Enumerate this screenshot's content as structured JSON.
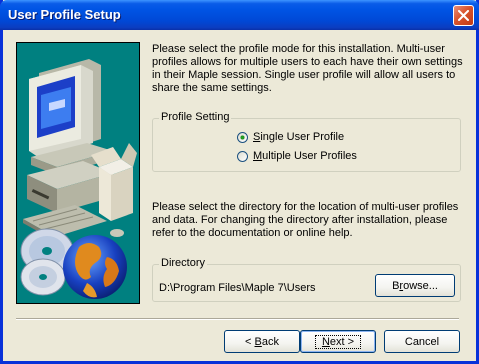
{
  "window": {
    "title": "User Profile Setup"
  },
  "intro_text": "Please select the profile mode for this installation.  Multi-user profiles allows for multiple users to each have their own settings in their Maple session.  Single user profile will allow all users to share the same settings.",
  "profile_group": {
    "label": "Profile Setting",
    "options": [
      {
        "pre": "",
        "key": "S",
        "post": "ingle User Profile",
        "selected": true
      },
      {
        "pre": "",
        "key": "M",
        "post": "ultiple User Profiles",
        "selected": false
      }
    ]
  },
  "directory_text": "Please select the directory for the location of multi-user profiles and data.  For changing the directory after installation, please refer to the documentation or online help.",
  "directory_group": {
    "label": "Directory",
    "path": "D:\\Program Files\\Maple 7\\Users",
    "browse_pre": "B",
    "browse_key": "r",
    "browse_post": "owse..."
  },
  "buttons": {
    "back_pre": "< ",
    "back_key": "B",
    "back_post": "ack",
    "next_key": "N",
    "next_post": "ext >",
    "cancel": "Cancel"
  },
  "colors": {
    "title_bar": "#0055e5",
    "art_background": "#008080",
    "dialog_background": "#ece9d8"
  },
  "icons": [
    "close-icon",
    "computer-illustration",
    "cd-icon",
    "globe-icon"
  ]
}
